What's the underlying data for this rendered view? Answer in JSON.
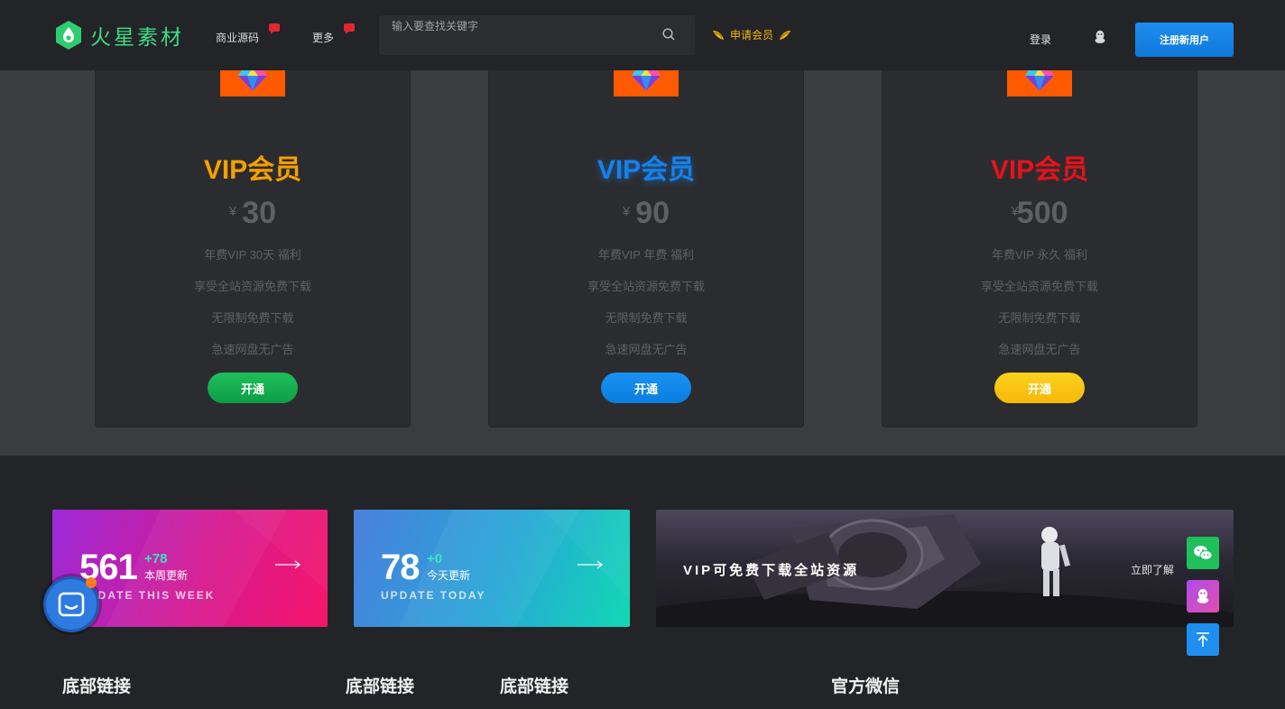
{
  "header": {
    "logo_text": "火星素材",
    "nav": [
      {
        "label": "商业源码"
      },
      {
        "label": "更多"
      }
    ],
    "search_placeholder": "输入要查找关键字",
    "apply_vip_label": "申请会员",
    "login_label": "登录",
    "register_label": "注册新用户"
  },
  "vip_plans": [
    {
      "title": "VIP会员",
      "currency": "¥",
      "price": "30",
      "title_color": "#f5a000",
      "features": [
        "年费VIP 30天 福利",
        "享受全站资源免费下载",
        "无限制免费下载",
        "急速网盘无广告"
      ],
      "button_label": "开通"
    },
    {
      "title": "VIP会员",
      "currency": "¥",
      "price": "90",
      "title_color": "#1781ea",
      "features": [
        "年费VIP 年费 福利",
        "享受全站资源免费下载",
        "无限制免费下载",
        "急速网盘无广告"
      ],
      "button_label": "开通"
    },
    {
      "title": "VIP会员",
      "currency": "¥",
      "price": "500",
      "title_color": "#e5121c",
      "features": [
        "年费VIP 永久 福利",
        "享受全站资源免费下载",
        "无限制免费下载",
        "急速网盘无广告"
      ],
      "button_label": "开通"
    }
  ],
  "stats": [
    {
      "number": "561",
      "plus": "+78",
      "sub": "本周更新",
      "en": "UPDATE THIS WEEK",
      "en_visible": "DATE THIS WEEK"
    },
    {
      "number": "78",
      "plus": "+0",
      "sub": "今天更新",
      "en": "UPDATE TODAY"
    }
  ],
  "banner": {
    "text": "VIP可免费下载全站资源",
    "link_label": "立即了解"
  },
  "footer": {
    "headings": [
      "底部链接",
      "底部链接",
      "底部链接",
      "官方微信"
    ]
  },
  "colors": {
    "accent_green": "#3ddc84",
    "register_blue": "#1e8ef0",
    "vip_icon_bg": "#ff5a00"
  },
  "icons": [
    "logo-mark-icon",
    "search-icon",
    "wing-icon",
    "qq-icon",
    "diamond-icon",
    "arrow-right-icon",
    "wechat-icon",
    "qq-service-icon",
    "back-to-top-icon",
    "chat-icon"
  ]
}
